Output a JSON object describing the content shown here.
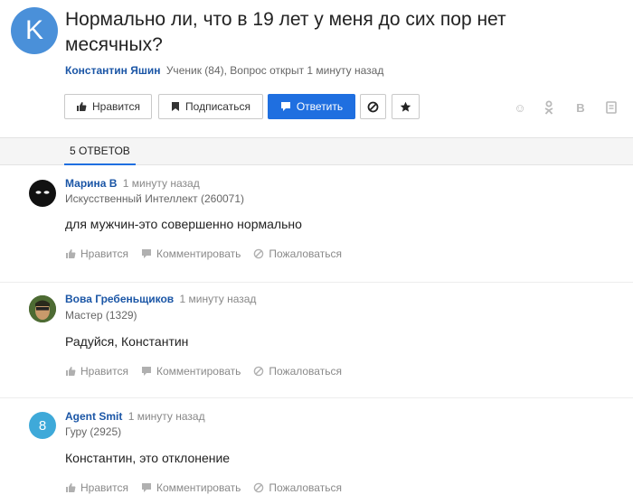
{
  "question": {
    "avatar_letter": "K",
    "title": "Нормально ли, что в 19 лет у меня до сих пор нет месячных?",
    "author": "Константин Яшин",
    "meta": "Ученик (84), Вопрос открыт 1 минуту назад"
  },
  "buttons": {
    "like": "Нравится",
    "subscribe": "Подписаться",
    "answer": "Ответить"
  },
  "share_icons": {
    "mm": "☺",
    "ok": "ok-icon",
    "vk": "B"
  },
  "tabs": [
    {
      "label": "5 ОТВЕТОВ"
    }
  ],
  "answers": [
    {
      "author": "Марина В",
      "time": "1 минуту назад",
      "rank": "Искусственный Интеллект (260071)",
      "text": "для мужчин-это совершенно нормально"
    },
    {
      "author": "Вова Гребеньщиков",
      "time": "1 минуту назад",
      "rank": "Мастер (1329)",
      "text": "Радуйся, Константин"
    },
    {
      "author": "Agent Smit",
      "time": "1 минуту назад",
      "rank": "Гуру (2925)",
      "text": "Константин, это отклонение",
      "avatar_letter": "8"
    }
  ],
  "actions": {
    "like": "Нравится",
    "comment": "Комментировать",
    "report": "Пожаловаться"
  },
  "colors": {
    "accent": "#1f6fe0",
    "link": "#1b56a6",
    "question_avatar": "#4a90d9",
    "answer3_avatar": "#3ea9d9"
  }
}
